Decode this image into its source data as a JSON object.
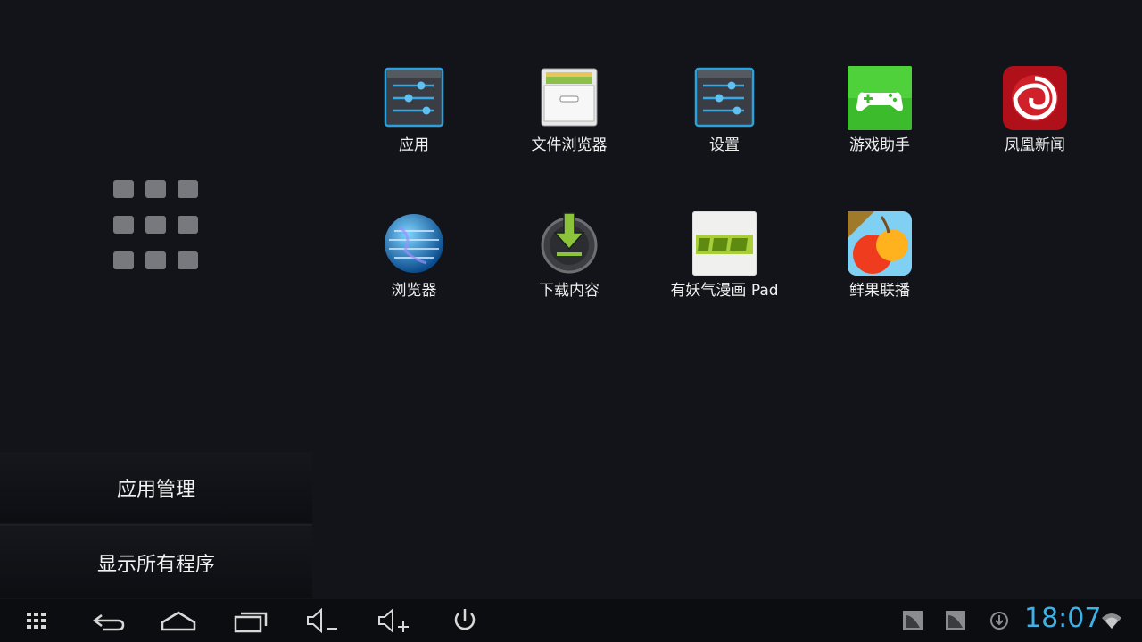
{
  "left_panel": {
    "grid_icon": "all-apps-grid-icon",
    "manage_label": "应用管理",
    "show_all_label": "显示所有程序"
  },
  "apps": [
    {
      "label": "应用",
      "icon": "settings-sliders-icon"
    },
    {
      "label": "文件浏览器",
      "icon": "file-cabinet-icon"
    },
    {
      "label": "设置",
      "icon": "settings-sliders-icon"
    },
    {
      "label": "游戏助手",
      "icon": "gamepad-icon"
    },
    {
      "label": "凤凰新闻",
      "icon": "phoenix-icon"
    },
    {
      "label": "浏览器",
      "icon": "globe-icon"
    },
    {
      "label": "下载内容",
      "icon": "download-icon"
    },
    {
      "label": "有妖气漫画 Pad",
      "icon": "comic-icon"
    },
    {
      "label": "鲜果联播",
      "icon": "cherry-hd-icon"
    }
  ],
  "navbar": {
    "buttons": [
      "apps-icon",
      "back-icon",
      "home-icon",
      "recents-icon",
      "volume-down-icon",
      "volume-up-icon",
      "power-icon"
    ],
    "clock": "18:07",
    "accent": "#3fb1e5"
  }
}
